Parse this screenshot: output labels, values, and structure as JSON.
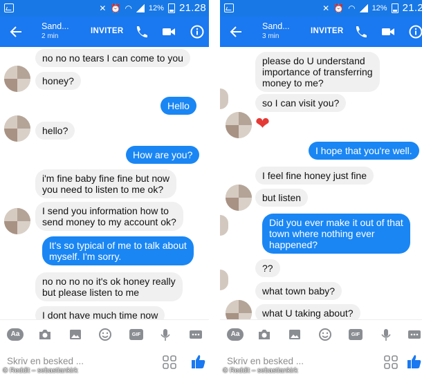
{
  "colors": {
    "header_blue": "#1a78f0",
    "status_blue": "#1878e6",
    "outgoing_bubble": "#1a86f4",
    "incoming_bubble": "#f0f0f0",
    "icon_gray": "#8a8d91"
  },
  "left": {
    "status": {
      "battery": "12%",
      "time": "21.28"
    },
    "header": {
      "name": "Sand...",
      "sub": "2 min",
      "invite": "INVITER"
    },
    "messages": [
      {
        "dir": "in",
        "text": "no no no tears I can come to you"
      },
      {
        "dir": "in",
        "text": "honey?"
      },
      {
        "dir": "out",
        "text": "Hello"
      },
      {
        "dir": "in",
        "text": "hello?"
      },
      {
        "dir": "out",
        "text": "How are you?"
      },
      {
        "dir": "in",
        "lines": [
          "i'm fine baby fine fine but now",
          "you need to listen to me ok?"
        ]
      },
      {
        "dir": "in",
        "lines": [
          "I send you information how to",
          "send money to my account ok?"
        ]
      },
      {
        "dir": "out",
        "lines": [
          "It's so typical of me to talk about",
          "myself. I'm sorry."
        ]
      },
      {
        "dir": "in",
        "lines": [
          "no no no no it's ok honey really",
          "but please listen to me"
        ]
      },
      {
        "dir": "in",
        "text": "I dont have much time now"
      }
    ],
    "composer_placeholder": "Skriv en besked ...",
    "credit": "© Reddit – sebastiankirk"
  },
  "right": {
    "status": {
      "battery": "12%",
      "time": "21.2"
    },
    "header": {
      "name": "Sand...",
      "sub": "3 min",
      "invite": "INVITER"
    },
    "messages": [
      {
        "dir": "in",
        "lines": [
          "please do U understand",
          "importance of transferring",
          "money to me?"
        ]
      },
      {
        "dir": "in",
        "text": "so I can visit you?"
      },
      {
        "dir": "in",
        "emoji": "❤"
      },
      {
        "dir": "out",
        "text": "I hope that you're well."
      },
      {
        "dir": "in",
        "text": "I feel fine honey just fine"
      },
      {
        "dir": "in",
        "text": "but listen"
      },
      {
        "dir": "out",
        "lines": [
          "Did you ever make it out of that",
          "town where nothing ever",
          "happened?"
        ]
      },
      {
        "dir": "in",
        "text": "??"
      },
      {
        "dir": "in",
        "text": "what town baby?"
      },
      {
        "dir": "in",
        "text": "what U taking about?"
      }
    ],
    "composer_placeholder": "Skriv en besked ...",
    "credit": "© Reddit – sebastiankirk"
  },
  "toolbar_icons": [
    "Aa",
    "camera-icon",
    "image-icon",
    "emoji-icon",
    "GIF",
    "microphone-icon",
    "more-icon"
  ]
}
